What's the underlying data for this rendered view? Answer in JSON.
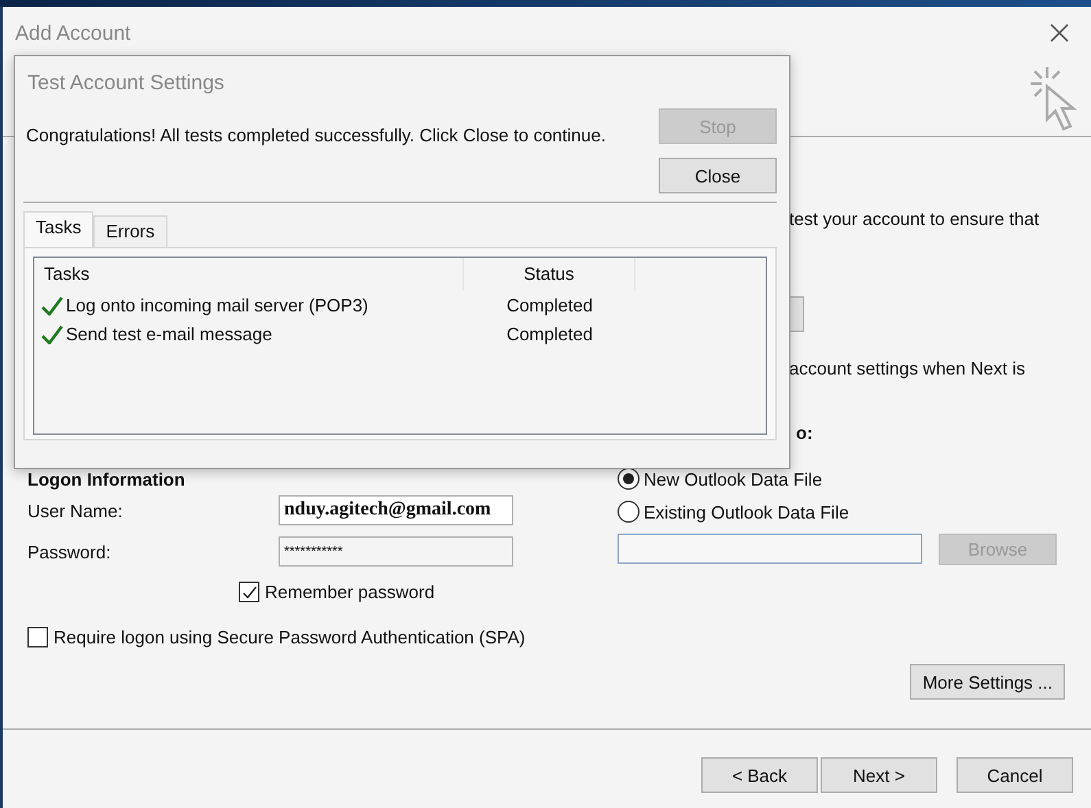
{
  "window": {
    "title": "Add Account"
  },
  "partial_texts": [
    "test your account to ensure that",
    "account settings when Next is"
  ],
  "deliver_heading": "o:",
  "logon": {
    "heading": "Logon Information",
    "user_name_label": "User Name:",
    "user_name": "nduy.agitech@gmail.com",
    "password_label": "Password:",
    "password": "***********",
    "remember": {
      "label": "Remember password",
      "checked": true
    },
    "spa": {
      "label": "Require logon using Secure Password Authentication (SPA)",
      "checked": false
    }
  },
  "data_file_options": [
    {
      "label": "New Outlook Data File",
      "selected": true
    },
    {
      "label": "Existing Outlook Data File",
      "selected": false
    }
  ],
  "browse": {
    "label": "Browse",
    "disabled": true
  },
  "more_settings": "More Settings ...",
  "buttons": [
    "< Back",
    "Next >",
    "Cancel"
  ],
  "dialog": {
    "title": "Test Account Settings",
    "message": "Congratulations! All tests completed successfully. Click Close to continue.",
    "stop": {
      "label": "Stop",
      "disabled": true
    },
    "close": "Close",
    "tabs": [
      {
        "label": "Tasks",
        "selected": true
      },
      {
        "label": "Errors",
        "selected": false
      }
    ],
    "columns": [
      "Tasks",
      "Status"
    ],
    "rows": [
      {
        "task": "Log onto incoming mail server (POP3)",
        "status": "Completed",
        "done": true
      },
      {
        "task": "Send test e-mail message",
        "status": "Completed",
        "done": true
      }
    ]
  }
}
